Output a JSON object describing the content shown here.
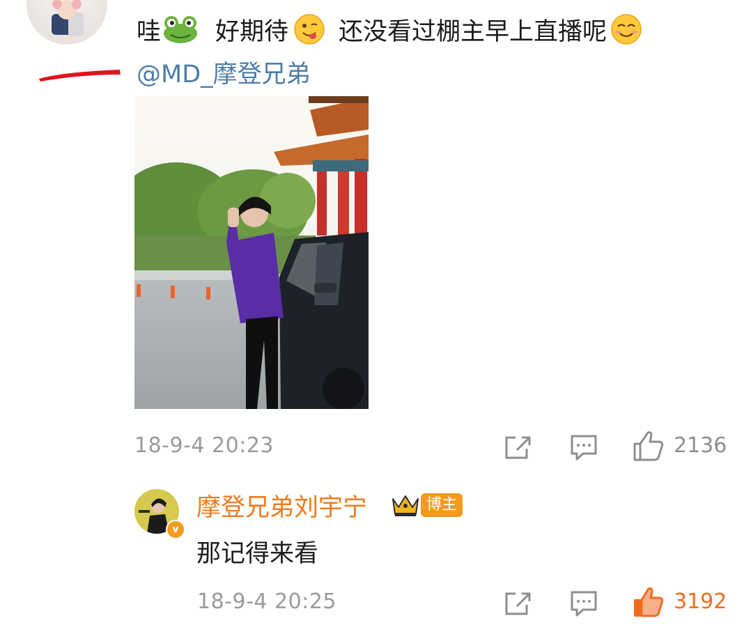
{
  "comment": {
    "text_parts": [
      "哇",
      "好期待",
      "还没看过棚主早上直播呢"
    ],
    "mention": "@MD_摩登兄弟",
    "emoji_icons": [
      "frog-emoji",
      "yum-emoji",
      "happy-emoji"
    ],
    "timestamp": "18-9-4 20:23",
    "like_count": "2136",
    "liked": false
  },
  "reply": {
    "username": "摩登兄弟刘宇宁",
    "owner_badge": "博主",
    "verified_mark": "v",
    "text": "那记得来看",
    "timestamp": "18-9-4 20:25",
    "like_count": "3192",
    "liked": true
  },
  "colors": {
    "mention": "#4d7da8",
    "username": "#f07a1c",
    "liked": "#f06c1d",
    "meta_gray": "#9a9a9a",
    "redaction": "#e0141e"
  },
  "icons": [
    "share-icon",
    "comment-icon",
    "like-icon",
    "crown-icon"
  ]
}
